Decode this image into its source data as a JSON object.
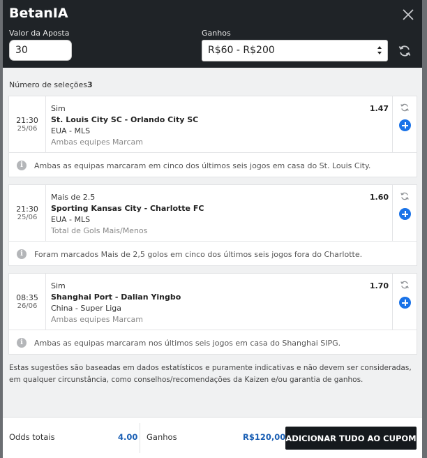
{
  "header": {
    "title": "BetanIA",
    "stake_label": "Valor da Aposta",
    "stake_value": "30",
    "winnings_label": "Ganhos",
    "winnings_range": "R$60 - R$200"
  },
  "selections_label": "Número de seleções",
  "selections_count": "3",
  "cards": [
    {
      "time": "21:30",
      "date": "25/06",
      "market": "Sim",
      "odd": "1.47",
      "match": "St. Louis City SC - Orlando City SC",
      "league": "EUA - MLS",
      "bet_type": "Ambas equipes Marcam",
      "note": "Ambas as equipas marcaram em cinco dos últimos seis jogos em casa do St. Louis City."
    },
    {
      "time": "21:30",
      "date": "25/06",
      "market": "Mais de 2.5",
      "odd": "1.60",
      "match": "Sporting Kansas City - Charlotte FC",
      "league": "EUA - MLS",
      "bet_type": "Total de Gols Mais/Menos",
      "note": "Foram marcados Mais de 2,5 golos em cinco dos últimos seis jogos fora do Charlotte."
    },
    {
      "time": "08:35",
      "date": "26/06",
      "market": "Sim",
      "odd": "1.70",
      "match": "Shanghai Port - Dalian Yingbo",
      "league": "China - Super Liga",
      "bet_type": "Ambas equipes Marcam",
      "note": "Ambas as equipas marcaram nos últimos seis jogos em casa do Shanghai SIPG."
    }
  ],
  "disclaimer_line1": "Estas sugestões são baseadas em dados estatísticos e puramente indicativas e não devem ser consideradas,",
  "disclaimer_line2": "em qualquer circunstância, como conselhos/recomendações da Kaizen e/ou garantia de ganhos.",
  "footer": {
    "total_odds_label": "Odds totais",
    "total_odds_value": "4.00",
    "winnings_label": "Ganhos",
    "winnings_value": "R$120,00",
    "add_all_label": "ADICIONAR TUDO AO CUPOM"
  },
  "icons": {
    "close": "close-icon",
    "refresh": "refresh-icon",
    "add": "plus-circle-icon",
    "info": "info-icon",
    "select_arrows": "select-arrows-icon"
  },
  "colors": {
    "header_bg": "#1f2327",
    "accent_blue": "#1a73e8",
    "value_blue": "#1a5fb4",
    "button_bg": "#15191d"
  }
}
